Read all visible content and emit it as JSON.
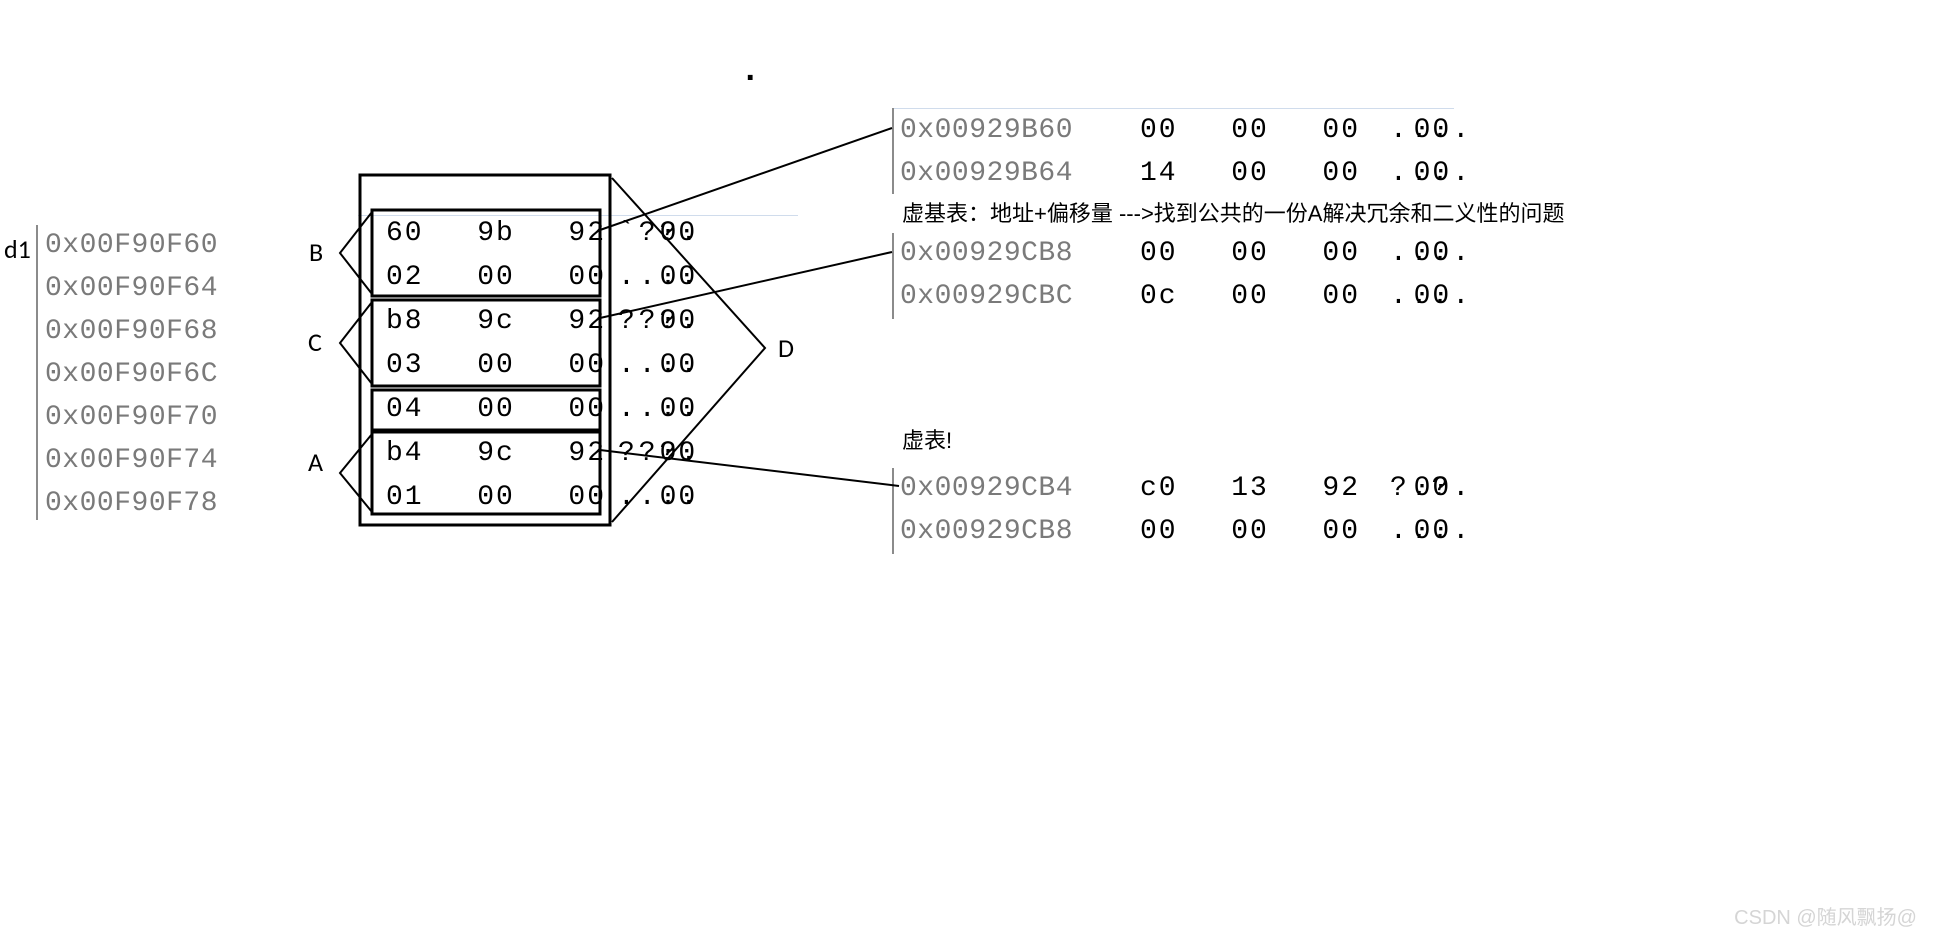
{
  "left_label": "d1",
  "left_addrs": [
    "0x00F90F60",
    "0x00F90F64",
    "0x00F90F68",
    "0x00F90F6C",
    "0x00F90F70",
    "0x00F90F74",
    "0x00F90F78"
  ],
  "center": {
    "label_B": "B",
    "label_C": "C",
    "label_A": "A",
    "rows": [
      {
        "bytes": "60  9b  92  00",
        "ascii": "`??."
      },
      {
        "bytes": "02  00  00  00",
        "ascii": "...."
      },
      {
        "bytes": "b8  9c  92  00",
        "ascii": "???."
      },
      {
        "bytes": "03  00  00  00",
        "ascii": "...."
      },
      {
        "bytes": "04  00  00  00",
        "ascii": "...."
      },
      {
        "bytes": "b4  9c  92  00",
        "ascii": "???."
      },
      {
        "bytes": "01  00  00  00",
        "ascii": "...."
      }
    ]
  },
  "label_D": "D",
  "top_dot": "·",
  "right_top": [
    {
      "addr": "0x00929B60",
      "bytes": "00  00  00  00",
      "ascii": "...."
    },
    {
      "addr": "0x00929B64",
      "bytes": "14  00  00  00",
      "ascii": "...."
    }
  ],
  "annotation_vbt": "虚基表：地址+偏移量 --->找到公共的一份A解决冗余和二义性的问题",
  "right_mid": [
    {
      "addr": "0x00929CB8",
      "bytes": "00  00  00  00",
      "ascii": "...."
    },
    {
      "addr": "0x00929CBC",
      "bytes": "0c  00  00  00",
      "ascii": "...."
    }
  ],
  "annotation_vt": "虚表!",
  "right_bot": [
    {
      "addr": "0x00929CB4",
      "bytes": "c0  13  92  00",
      "ascii": "?.?."
    },
    {
      "addr": "0x00929CB8",
      "bytes": "00  00  00  00",
      "ascii": "...."
    }
  ],
  "watermark": "CSDN @随风飘扬@"
}
